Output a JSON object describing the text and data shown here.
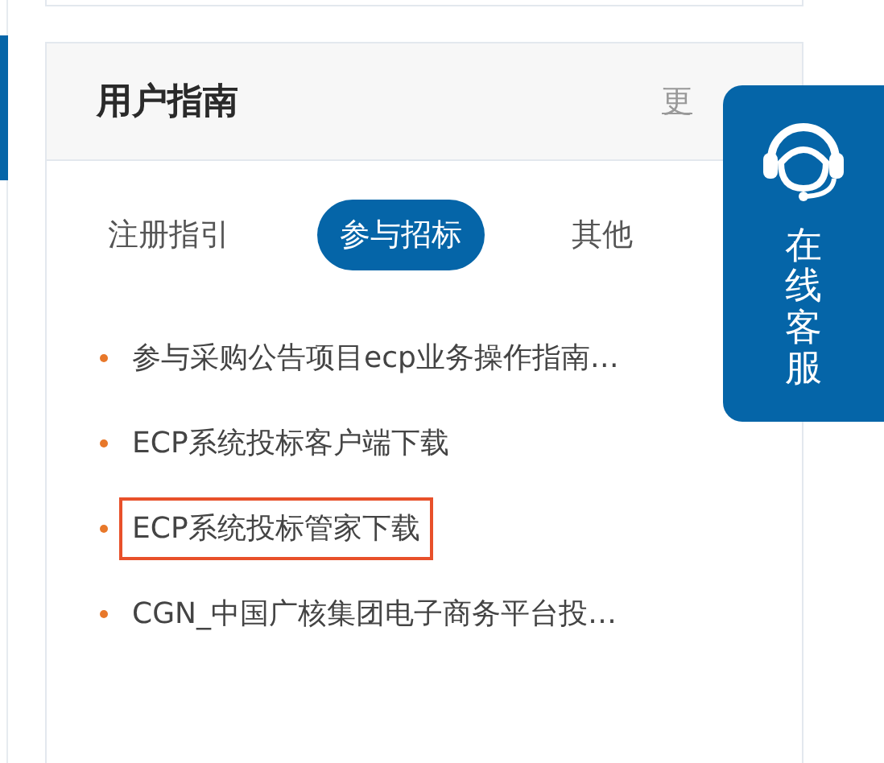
{
  "guide": {
    "title": "用户指南",
    "more": "更",
    "tabs": [
      {
        "label": "注册指引",
        "selected": false
      },
      {
        "label": "参与招标",
        "selected": true
      },
      {
        "label": "其他",
        "selected": false
      }
    ],
    "items": [
      {
        "text": "参与采购公告项目ecp业务操作指南…",
        "highlighted": false
      },
      {
        "text": "ECP系统投标客户端下载",
        "highlighted": false
      },
      {
        "text": "ECP系统投标管家下载",
        "highlighted": true
      },
      {
        "text": "CGN_中国广核集团电子商务平台投…",
        "highlighted": false
      }
    ]
  },
  "service": {
    "label": "在线客服"
  }
}
